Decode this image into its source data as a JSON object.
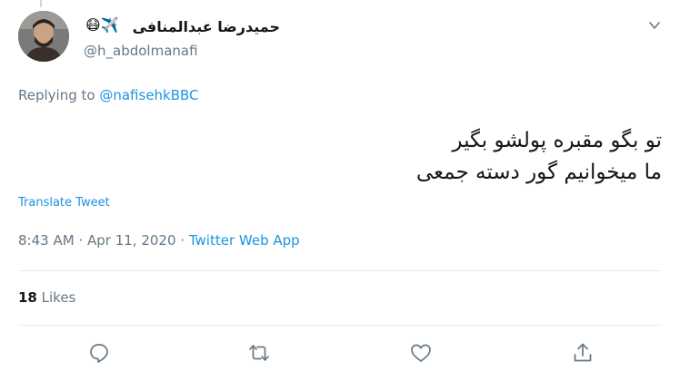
{
  "tweet": {
    "author": {
      "display_name": "حمیدرضا عبدالمنافی",
      "name_emoji": "😷✈️",
      "handle": "@h_abdolmanafi"
    },
    "reply_context": {
      "prefix": "Replying to",
      "mention": "@nafisehkBBC"
    },
    "text_lines": [
      "تو بگو مقبره پولشو بگیر",
      "ما میخوانیم گور دسته جمعی"
    ],
    "translate_label": "Translate Tweet",
    "time": "8:43 AM",
    "separator": "·",
    "date": "Apr 11, 2020",
    "source": "Twitter Web App",
    "likes": {
      "count": "18",
      "label": "Likes"
    }
  },
  "icons": {
    "more": "chevron-down-icon",
    "reply": "reply-icon",
    "retweet": "retweet-icon",
    "like": "heart-icon",
    "share": "share-icon"
  },
  "colors": {
    "link": "#1b95e0",
    "muted": "#657786",
    "divider": "#e6ecf0",
    "text": "#14171a"
  }
}
